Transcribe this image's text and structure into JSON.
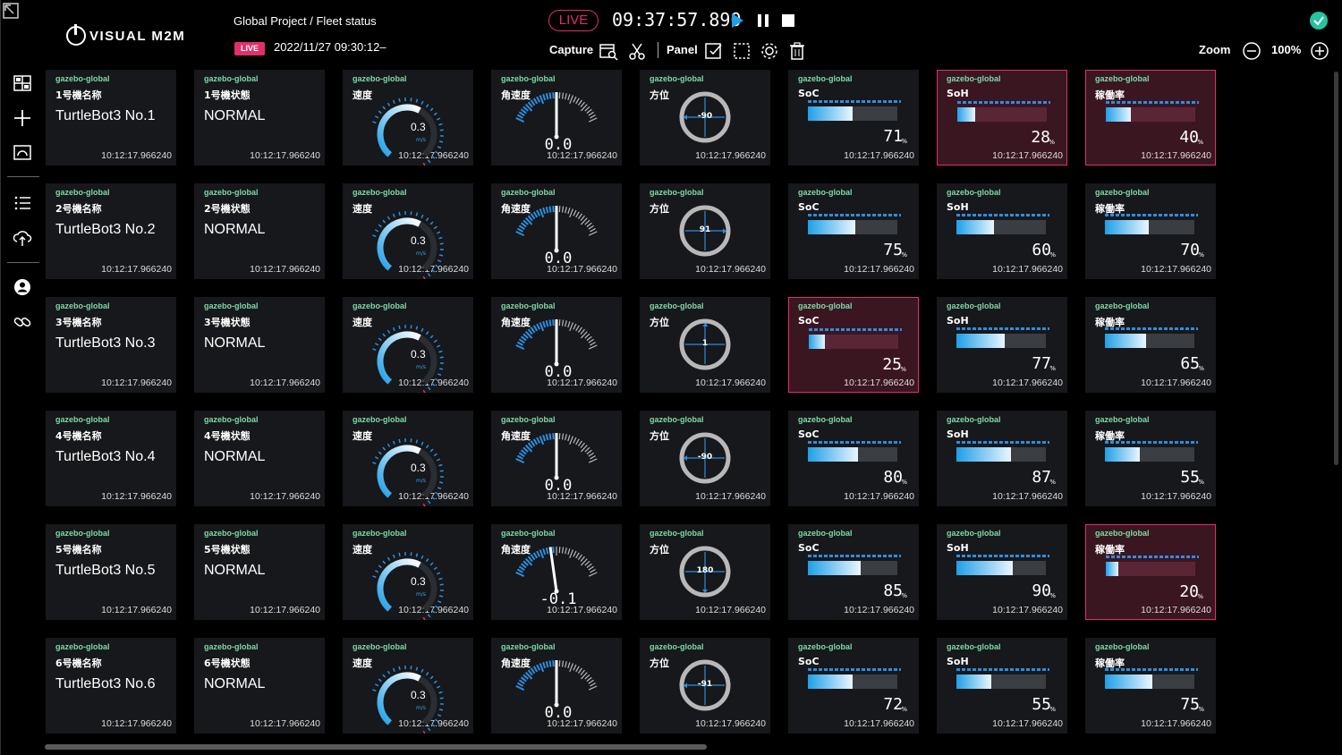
{
  "header": {
    "logo_text": "VISUAL M2M",
    "breadcrumb": "Global Project / Fleet status",
    "live_badge_small": "LIVE",
    "datetime": "2022/11/27 09:30:12–",
    "live_badge_big": "LIVE",
    "clock": "09:37:57.890",
    "capture_label": "Capture",
    "panel_label": "Panel",
    "zoom_label": "Zoom",
    "zoom_value": "100%"
  },
  "colors": {
    "accent_blue": "#1f9fe6",
    "alert_pink": "#e0306a",
    "source_green": "#7fd8a8",
    "ok_green": "#27c3a0"
  },
  "source_label": "gazebo-global",
  "timestamp": "10:12:17.966240",
  "labels": {
    "speed": "速度",
    "angular_speed": "角速度",
    "heading": "方位",
    "soc": "SoC",
    "soh": "SoH",
    "uptime": "稼働率",
    "speed_unit": "m/s",
    "percent": "%"
  },
  "robots": [
    {
      "name_label": "1号機名称",
      "name": "TurtleBot3 No.1",
      "state_label": "1号機状態",
      "state": "NORMAL",
      "speed": 0.3,
      "speed_text": "0.3",
      "angular": 0.0,
      "angular_text": "0.0",
      "heading": -90,
      "heading_text": "-90",
      "soc": 71,
      "soc_text": "71",
      "soh": 28,
      "soh_text": "28",
      "uptime": 40,
      "uptime_text": "40",
      "alerts": {
        "soc": false,
        "soh": true,
        "uptime": true
      }
    },
    {
      "name_label": "2号機名称",
      "name": "TurtleBot3 No.2",
      "state_label": "2号機状態",
      "state": "NORMAL",
      "speed": 0.3,
      "speed_text": "0.3",
      "angular": 0.0,
      "angular_text": "0.0",
      "heading": 91,
      "heading_text": "91",
      "soc": 75,
      "soc_text": "75",
      "soh": 60,
      "soh_text": "60",
      "uptime": 70,
      "uptime_text": "70",
      "alerts": {
        "soc": false,
        "soh": false,
        "uptime": false
      }
    },
    {
      "name_label": "3号機名称",
      "name": "TurtleBot3 No.3",
      "state_label": "3号機状態",
      "state": "NORMAL",
      "speed": 0.3,
      "speed_text": "0.3",
      "angular": 0.0,
      "angular_text": "0.0",
      "heading": 1,
      "heading_text": "1",
      "soc": 25,
      "soc_text": "25",
      "soh": 77,
      "soh_text": "77",
      "uptime": 65,
      "uptime_text": "65",
      "alerts": {
        "soc": true,
        "soh": false,
        "uptime": false
      }
    },
    {
      "name_label": "4号機名称",
      "name": "TurtleBot3 No.4",
      "state_label": "4号機状態",
      "state": "NORMAL",
      "speed": 0.3,
      "speed_text": "0.3",
      "angular": 0.0,
      "angular_text": "0.0",
      "heading": -90,
      "heading_text": "-90",
      "soc": 80,
      "soc_text": "80",
      "soh": 87,
      "soh_text": "87",
      "uptime": 55,
      "uptime_text": "55",
      "alerts": {
        "soc": false,
        "soh": false,
        "uptime": false
      }
    },
    {
      "name_label": "5号機名称",
      "name": "TurtleBot3 No.5",
      "state_label": "5号機状態",
      "state": "NORMAL",
      "speed": 0.3,
      "speed_text": "0.3",
      "angular": -0.1,
      "angular_text": "-0.1",
      "heading": 180,
      "heading_text": "180",
      "soc": 85,
      "soc_text": "85",
      "soh": 90,
      "soh_text": "90",
      "uptime": 20,
      "uptime_text": "20",
      "alerts": {
        "soc": false,
        "soh": false,
        "uptime": true
      }
    },
    {
      "name_label": "6号機名称",
      "name": "TurtleBot3 No.6",
      "state_label": "6号機状態",
      "state": "NORMAL",
      "speed": 0.3,
      "speed_text": "0.3",
      "angular": 0.0,
      "angular_text": "0.0",
      "heading": -91,
      "heading_text": "-91",
      "soc": 72,
      "soc_text": "72",
      "soh": 55,
      "soh_text": "55",
      "uptime": 75,
      "uptime_text": "75",
      "alerts": {
        "soc": false,
        "soh": false,
        "uptime": false
      }
    }
  ]
}
